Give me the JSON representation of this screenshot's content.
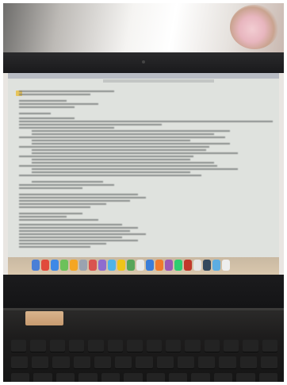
{
  "screen": {
    "brand_text": "",
    "dock_icon_colors": [
      "#4a7fd6",
      "#e14b3b",
      "#3f89e6",
      "#6cc15a",
      "#f5a623",
      "#9aa3b0",
      "#d9534f",
      "#8e6ccf",
      "#4fb3e8",
      "#f0c419",
      "#57a55a",
      "#e8e8e8",
      "#3b7dd8",
      "#f07a2c",
      "#9b59b6",
      "#2ecc71",
      "#c0392b",
      "#e5e5e5",
      "#34495e",
      "#5dade2",
      "#eeeeee"
    ]
  }
}
